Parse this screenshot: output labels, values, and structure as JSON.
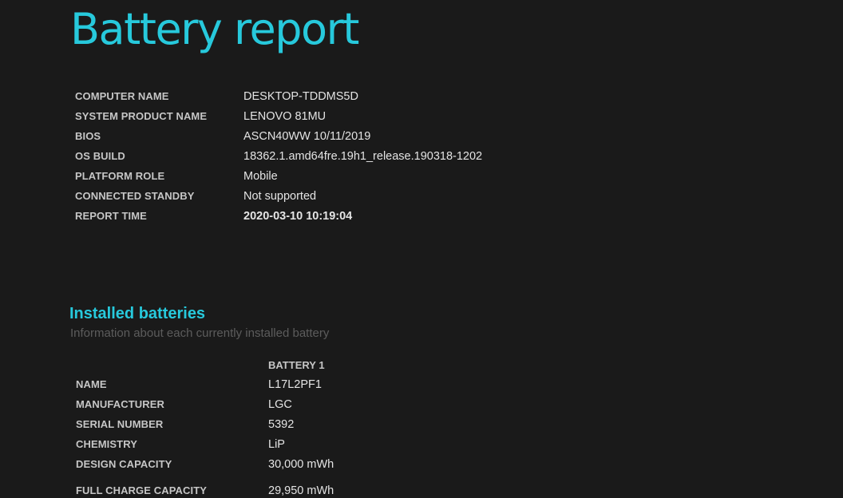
{
  "title": "Battery report",
  "system_info": [
    {
      "label": "COMPUTER NAME",
      "value": "DESKTOP-TDDMS5D"
    },
    {
      "label": "SYSTEM PRODUCT NAME",
      "value": "LENOVO 81MU"
    },
    {
      "label": "BIOS",
      "value": "ASCN40WW 10/11/2019"
    },
    {
      "label": "OS BUILD",
      "value": "18362.1.amd64fre.19h1_release.190318-1202"
    },
    {
      "label": "PLATFORM ROLE",
      "value": "Mobile"
    },
    {
      "label": "CONNECTED STANDBY",
      "value": "Not supported"
    },
    {
      "label": "REPORT TIME",
      "value": "2020-03-10  10:19:04"
    }
  ],
  "installed_batteries": {
    "title": "Installed batteries",
    "subtitle": "Information about each currently installed battery",
    "column_header": "BATTERY 1",
    "rows": [
      {
        "label": "NAME",
        "value": "L17L2PF1"
      },
      {
        "label": "MANUFACTURER",
        "value": "LGC"
      },
      {
        "label": "SERIAL NUMBER",
        "value": "5392"
      },
      {
        "label": "CHEMISTRY",
        "value": "LiP"
      },
      {
        "label": "DESIGN CAPACITY",
        "value": "30,000 mWh"
      },
      {
        "label": "FULL CHARGE CAPACITY",
        "value": "29,950 mWh"
      }
    ]
  }
}
